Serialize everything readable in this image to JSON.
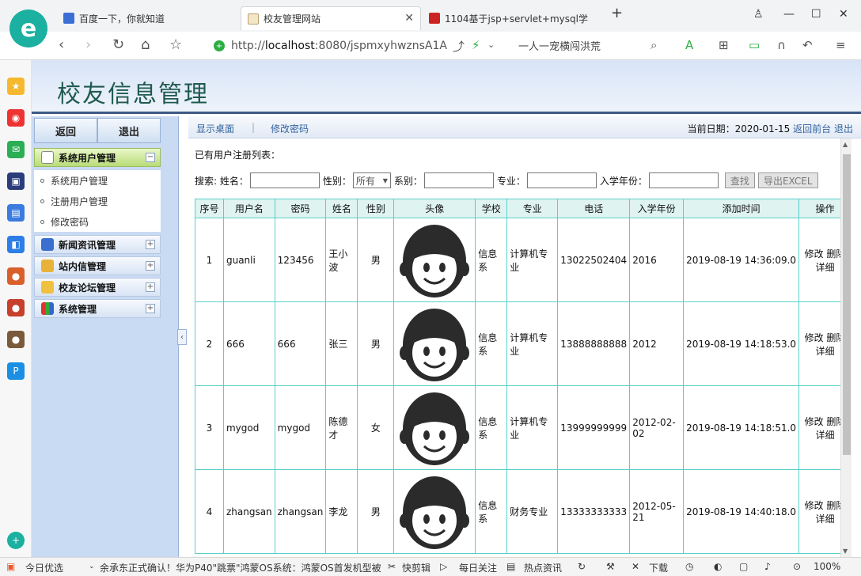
{
  "browser": {
    "tabs": [
      {
        "title": "百度一下，你就知道",
        "active": false
      },
      {
        "title": "校友管理网站",
        "active": true
      },
      {
        "title": "1104基于jsp+servlet+mysql学",
        "active": false
      }
    ],
    "url_prefix": "http://",
    "url_host": "localhost",
    "url_rest": ":8080/jspmxyhwznsA1A",
    "search_hint": "一人一宠横闯洪荒",
    "accent": "#1bb0a0"
  },
  "header": {
    "title": "校友信息管理"
  },
  "menu": {
    "back": "返回",
    "exit": "退出",
    "groups": [
      {
        "label": "系统用户管理",
        "icon": "gear-icon",
        "toggle": "−"
      },
      {
        "label": "新闻资讯管理",
        "icon": "monitor-icon",
        "toggle": "+"
      },
      {
        "label": "站内信管理",
        "icon": "envelope-icon",
        "toggle": "+"
      },
      {
        "label": "校友论坛管理",
        "icon": "forum-icon",
        "toggle": "+"
      },
      {
        "label": "系统管理",
        "icon": "chart-icon",
        "toggle": "+"
      }
    ],
    "subitems": [
      "系统用户管理",
      "注册用户管理",
      "修改密码"
    ]
  },
  "toolbar": {
    "link1": "显示桌面",
    "link2": "修改密码",
    "date_label": "当前日期：2020-01-15",
    "front": "返回前台",
    "logout": "退出"
  },
  "list": {
    "title": "已有用户注册列表：",
    "search": {
      "prefix": "搜索: 姓名：",
      "gender_label": "性别：",
      "gender_value": "所有",
      "dept_label": "系别：",
      "major_label": "专业：",
      "year_label": "入学年份：",
      "find_btn": "查找",
      "export_btn": "导出EXCEL"
    },
    "columns": [
      "序号",
      "用户名",
      "密码",
      "姓名",
      "性别",
      "头像",
      "学校",
      "专业",
      "电话",
      "入学年份",
      "添加时间",
      "操作"
    ],
    "rows": [
      {
        "no": "1",
        "user": "guanli",
        "pwd": "123456",
        "name": "王小波",
        "sex": "男",
        "school": "信息系",
        "major": "计算机专业",
        "phone": "13022502404",
        "year": "2016",
        "time": "2019-08-19 14:36:09.0"
      },
      {
        "no": "2",
        "user": "666",
        "pwd": "666",
        "name": "张三",
        "sex": "男",
        "school": "信息系",
        "major": "计算机专业",
        "phone": "13888888888",
        "year": "2012",
        "time": "2019-08-19 14:18:53.0"
      },
      {
        "no": "3",
        "user": "mygod",
        "pwd": "mygod",
        "name": "陈德才",
        "sex": "女",
        "school": "信息系",
        "major": "计算机专业",
        "phone": "13999999999",
        "year": "2012-02-02",
        "time": "2019-08-19 14:18:51.0"
      },
      {
        "no": "4",
        "user": "zhangsan",
        "pwd": "zhangsan",
        "name": "李龙",
        "sex": "男",
        "school": "信息系",
        "major": "财务专业",
        "phone": "13333333333",
        "year": "2012-05-21",
        "time": "2019-08-19 14:40:18.0"
      }
    ],
    "ops": {
      "edit": "修改",
      "del": "删除",
      "detail": "详细"
    }
  },
  "statusbar": {
    "news": "今日优选",
    "headline": "余承东正式确认！华为P40\"跳票\"鸿蒙OS系统：鸿蒙OS首发机型被",
    "clip": "快剪辑",
    "daily": "每日关注",
    "hot": "热点资讯",
    "download": "下载",
    "zoom": "100%"
  }
}
